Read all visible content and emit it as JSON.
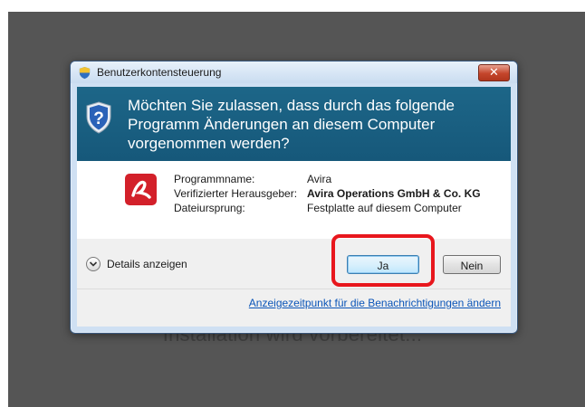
{
  "background": {
    "status_text": "Installation wird vorbereitet..."
  },
  "dialog": {
    "title": "Benutzerkontensteuerung",
    "close_label": "✕",
    "question": "Möchten Sie zulassen, dass durch das folgende Programm Änderungen an diesem Computer vorgenommen werden?",
    "program_info": [
      {
        "label": "Programmname:",
        "value": "Avira",
        "bold": false
      },
      {
        "label": "Verifizierter Herausgeber:",
        "value": "Avira Operations GmbH & Co. KG",
        "bold": true
      },
      {
        "label": "Dateiursprung:",
        "value": "Festplatte auf diesem Computer",
        "bold": false
      }
    ],
    "details_label": "Details anzeigen",
    "yes_label": "Ja",
    "no_label": "Nein",
    "notification_link": "Anzeigezeitpunkt für die Benachrichtigungen ändern"
  },
  "icons": {
    "title_icon": "uac-shield-icon",
    "header_icon": "uac-question-shield-icon",
    "program_icon": "avira-logo-icon",
    "details_icon": "chevron-down-icon",
    "close_icon": "close-icon"
  },
  "colors": {
    "header_band": "#16587a",
    "avira_red": "#d3202a",
    "highlight": "#e8171d",
    "link": "#0b55b8"
  }
}
